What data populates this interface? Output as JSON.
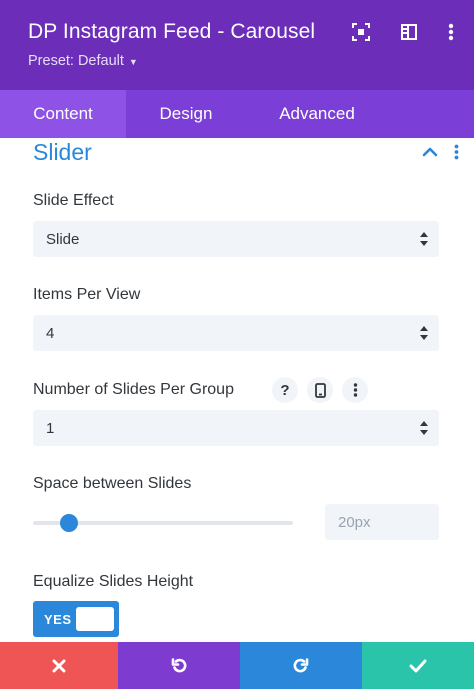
{
  "header": {
    "title": "DP Instagram Feed - Carousel",
    "preset_label": "Preset: Default"
  },
  "tabs": [
    {
      "label": "Content",
      "active": true
    },
    {
      "label": "Design",
      "active": false
    },
    {
      "label": "Advanced",
      "active": false
    }
  ],
  "section": {
    "title": "Slider"
  },
  "fields": {
    "slide_effect": {
      "label": "Slide Effect",
      "value": "Slide"
    },
    "items_per_view": {
      "label": "Items Per View",
      "value": "4"
    },
    "slides_per_group": {
      "label": "Number of Slides Per Group",
      "value": "1",
      "help_glyph": "?"
    },
    "space_between": {
      "label": "Space between Slides",
      "value": "20px",
      "slider_fraction": 0.14
    },
    "equalize_height": {
      "label": "Equalize Slides Height",
      "toggle_label": "YES",
      "on": true
    }
  },
  "icons": {
    "header": [
      "focus-icon",
      "sidebar-layout-icon",
      "more-vertical-icon"
    ],
    "footer": [
      "close-icon",
      "undo-icon",
      "redo-icon",
      "check-icon"
    ]
  },
  "colors": {
    "header_bg": "#6c2eb9",
    "tabs_bg": "#7b3ed6",
    "tab_active_bg": "#8f52e6",
    "accent_blue": "#2b87da",
    "input_bg": "#f1f5f9",
    "footer_cancel": "#ef5555",
    "footer_undo": "#7e3bd0",
    "footer_redo": "#2b87da",
    "footer_save": "#29c4a9"
  }
}
